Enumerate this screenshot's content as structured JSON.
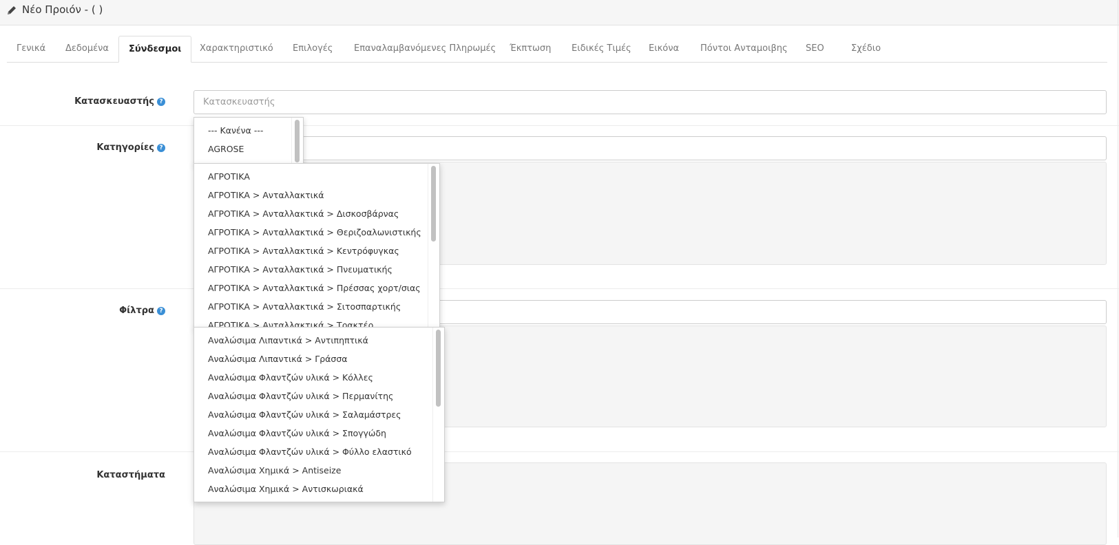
{
  "header": {
    "title": "Νέο Προιόν -  ( )",
    "icon": "pencil-icon"
  },
  "tabs": [
    {
      "label": "Γενικά"
    },
    {
      "label": "Δεδομένα"
    },
    {
      "label": "Σύνδεσμοι"
    },
    {
      "label": "Χαρακτηριστικό"
    },
    {
      "label": "Επιλογές"
    },
    {
      "label": "Επαναλαμβανόμενες Πληρωμές"
    },
    {
      "label": "Έκπτωση"
    },
    {
      "label": "Ειδικές Τιμές"
    },
    {
      "label": "Εικόνα"
    },
    {
      "label": "Πόντοι Ανταμοιβης"
    },
    {
      "label": "SEO"
    },
    {
      "label": "Σχέδιο"
    }
  ],
  "active_tab": "Σύνδεσμοι",
  "form": {
    "manufacturer": {
      "label": "Κατασκευαστής",
      "placeholder": "Κατασκευαστής",
      "value": ""
    },
    "categories": {
      "label": "Κατηγορίες",
      "value": ""
    },
    "filters": {
      "label": "Φίλτρα",
      "value": ""
    },
    "stores": {
      "label": "Καταστήματα"
    }
  },
  "dropdowns": {
    "manufacturer": [
      "--- Κανένα ---",
      "AGROSE"
    ],
    "categories": [
      "ΑΓΡΟΤΙΚΑ",
      "ΑΓΡΟΤΙΚΑ  >  Ανταλλακτικά",
      "ΑΓΡΟΤΙΚΑ  >  Ανταλλακτικά  >  Δισκοσβάρνας",
      "ΑΓΡΟΤΙΚΑ  >  Ανταλλακτικά  >  Θεριζοαλωνιστικής",
      "ΑΓΡΟΤΙΚΑ  >  Ανταλλακτικά  >  Κεντρόφυγκας",
      "ΑΓΡΟΤΙΚΑ  >  Ανταλλακτικά  >  Πνευματικής",
      "ΑΓΡΟΤΙΚΑ  >  Ανταλλακτικά  >  Πρέσσας χορτ/σιας",
      "ΑΓΡΟΤΙΚΑ  >  Ανταλλακτικά  >  Σιτοσπαρτικής",
      "ΑΓΡΟΤΙΚΑ  >  Ανταλλακτικά  >  Τρακτέρ"
    ],
    "filters": [
      "Αναλώσιμα Λιπαντικά > Αντιπηπτικά",
      "Αναλώσιμα Λιπαντικά > Γράσσα",
      "Αναλώσιμα Φλαντζών υλικά > Κόλλες",
      "Αναλώσιμα Φλαντζών υλικά > Περμανίτης",
      "Αναλώσιμα Φλαντζών υλικά > Σαλαμάστρες",
      "Αναλώσιμα Φλαντζών υλικά > Σπογγώδη",
      "Αναλώσιμα Φλαντζών υλικά > Φύλλο ελαστικό",
      "Αναλώσιμα Χημικά > Antiseize",
      "Αναλώσιμα Χημικά > Αντισκωριακά"
    ]
  },
  "colors": {
    "help_icon": "#3a8fd6",
    "well_bg": "#f5f5f5"
  }
}
